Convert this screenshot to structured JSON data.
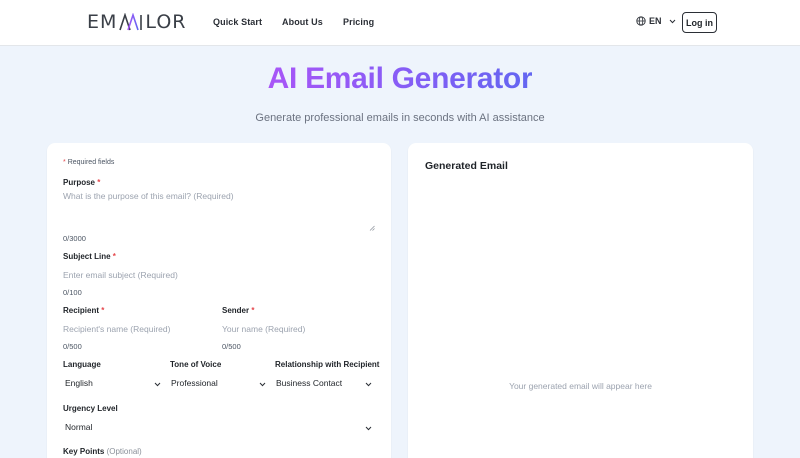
{
  "header": {
    "logo_text_left": "EM",
    "logo_text_right": "LOR",
    "nav": [
      "Quick Start",
      "About Us",
      "Pricing"
    ],
    "language": "EN",
    "login_label": "Log in"
  },
  "hero": {
    "title": "AI Email Generator",
    "subtitle": "Generate professional emails in seconds with AI assistance"
  },
  "form": {
    "required_note_star": "*",
    "required_note": "Required fields",
    "purpose": {
      "label": "Purpose",
      "star": "*",
      "placeholder": "What is the purpose of this email? (Required)",
      "count": "0/3000"
    },
    "subject": {
      "label": "Subject Line",
      "star": "*",
      "placeholder": "Enter email subject (Required)",
      "count": "0/100"
    },
    "recipient": {
      "label": "Recipient",
      "star": "*",
      "placeholder": "Recipient's name (Required)",
      "count": "0/500"
    },
    "sender": {
      "label": "Sender",
      "star": "*",
      "placeholder": "Your name (Required)",
      "count": "0/500"
    },
    "language": {
      "label": "Language",
      "value": "English"
    },
    "tone": {
      "label": "Tone of Voice",
      "value": "Professional"
    },
    "relationship": {
      "label": "Relationship with Recipient",
      "value": "Business Contact"
    },
    "urgency": {
      "label": "Urgency Level",
      "value": "Normal"
    },
    "key_points": {
      "label": "Key Points",
      "optional": "(Optional)"
    }
  },
  "output": {
    "title": "Generated Email",
    "empty_text": "Your generated email will appear here"
  },
  "colors": {
    "background": "#eef4fc",
    "gradient_start": "#a855f7",
    "gradient_end": "#6366f1",
    "required_star": "#e5484d"
  },
  "icons": [
    "globe-icon",
    "chevron-down-icon",
    "resize-handle-icon"
  ]
}
